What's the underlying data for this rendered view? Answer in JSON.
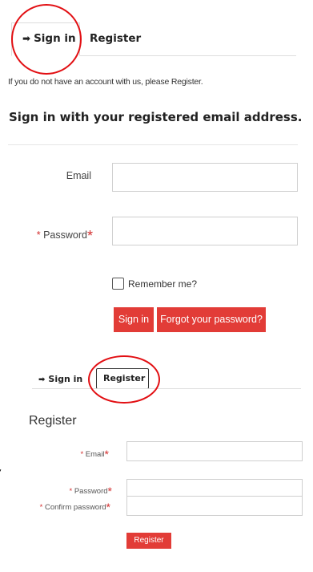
{
  "top_panel": {
    "tabs": [
      {
        "icon": "sign-in-icon",
        "label": "Sign in",
        "active": true
      },
      {
        "label": "Register",
        "active": false
      }
    ],
    "info_text": "If you do not have an account with us, please Register.",
    "heading": "Sign in with your registered email address.",
    "email_label": "Email",
    "password_required": "*",
    "password_label": "Password",
    "password_star": "*",
    "remember_label": "Remember me?",
    "signin_button": "Sign in",
    "forgot_button": "Forgot your password?"
  },
  "bottom_panel": {
    "tabs": [
      {
        "icon": "sign-in-icon",
        "label": "Sign in",
        "active": false
      },
      {
        "label": "Register",
        "active": true
      }
    ],
    "heading": "Register",
    "email_required": "*",
    "email_label": "Email",
    "email_star": "*",
    "password_required": "*",
    "password_label": "Password",
    "password_star": "*",
    "confirm_required": "*",
    "confirm_label": "Confirm password",
    "confirm_star": "*",
    "register_button": "Register"
  },
  "side_glyph": "ี้",
  "colors": {
    "accent_red": "#e23c37",
    "annotation_red": "#e20f13",
    "required_red": "#d32f2f"
  }
}
